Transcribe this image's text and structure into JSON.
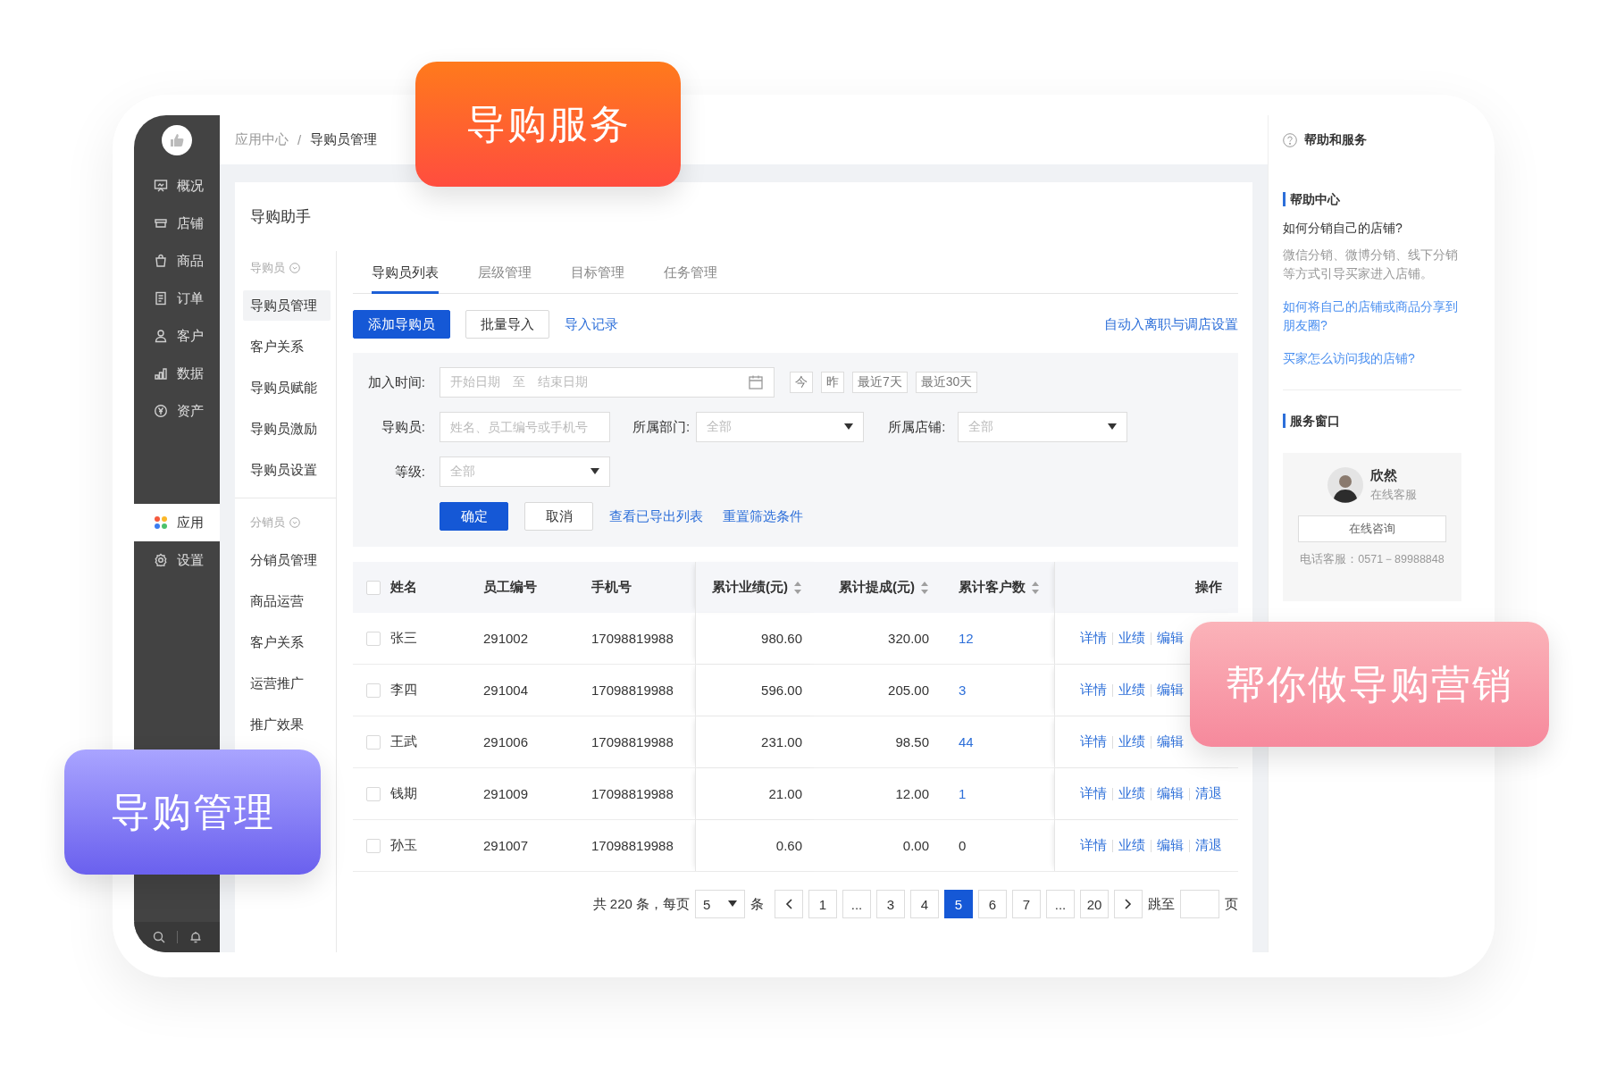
{
  "overlays": {
    "top_badge": "导购服务",
    "right_badge": "帮你做导购营销",
    "left_badge": "导购管理"
  },
  "sidebar": {
    "groups": [
      [
        {
          "label": "概况",
          "selected": false
        },
        {
          "label": "店铺",
          "selected": false
        },
        {
          "label": "商品",
          "selected": false
        },
        {
          "label": "订单",
          "selected": false
        },
        {
          "label": "客户",
          "selected": false
        },
        {
          "label": "数据",
          "selected": false
        },
        {
          "label": "资产",
          "selected": false
        }
      ],
      [
        {
          "label": "应用",
          "selected": true
        },
        {
          "label": "设置",
          "selected": false
        }
      ]
    ]
  },
  "breadcrumb": {
    "items": [
      "应用中心",
      "导购员管理"
    ],
    "separator": "/"
  },
  "app_title": "导购助手",
  "submenu": {
    "groups": [
      {
        "label": "导购员",
        "items": [
          {
            "label": "导购员管理",
            "selected": true
          },
          {
            "label": "客户关系",
            "selected": false
          },
          {
            "label": "导购员赋能",
            "selected": false
          },
          {
            "label": "导购员激励",
            "selected": false
          },
          {
            "label": "导购员设置",
            "selected": false
          }
        ]
      },
      {
        "label": "分销员",
        "items": [
          {
            "label": "分销员管理",
            "selected": false
          },
          {
            "label": "商品运营",
            "selected": false
          },
          {
            "label": "客户关系",
            "selected": false
          },
          {
            "label": "运营推广",
            "selected": false
          },
          {
            "label": "推广效果",
            "selected": false
          }
        ]
      }
    ]
  },
  "tabs": [
    {
      "label": "导购员列表",
      "selected": true
    },
    {
      "label": "层级管理",
      "selected": false
    },
    {
      "label": "目标管理",
      "selected": false
    },
    {
      "label": "任务管理",
      "selected": false
    }
  ],
  "toolbar": {
    "buttons": [
      {
        "label": "添加导购员",
        "kind": "primary"
      },
      {
        "label": "批量导入",
        "kind": "default"
      },
      {
        "label": "导入记录",
        "kind": "link"
      }
    ],
    "right_link": "自动入离职与调店设置"
  },
  "filters": {
    "date": {
      "label": "加入时间:",
      "start_placeholder": "开始日期",
      "separator": "至",
      "end_placeholder": "结束日期",
      "quick": [
        "今",
        "昨",
        "最近7天",
        "最近30天"
      ]
    },
    "guide": {
      "label": "导购员:",
      "placeholder": "姓名、员工编号或手机号"
    },
    "department": {
      "label": "所属部门:",
      "placeholder": "全部"
    },
    "store": {
      "label": "所属店铺:",
      "placeholder": "全部"
    },
    "level": {
      "label": "等级:",
      "placeholder": "全部"
    },
    "actions": [
      {
        "label": "确定",
        "kind": "primary"
      },
      {
        "label": "取消",
        "kind": "default"
      },
      {
        "label": "查看已导出列表",
        "kind": "link"
      },
      {
        "label": "重置筛选条件",
        "kind": "link"
      }
    ]
  },
  "table": {
    "select_all_checked": false,
    "columns": [
      {
        "label": "姓名",
        "sortable": false
      },
      {
        "label": "员工编号",
        "sortable": false
      },
      {
        "label": "手机号",
        "sortable": false
      },
      {
        "label": "累计业绩(元)",
        "sortable": true
      },
      {
        "label": "累计提成(元)",
        "sortable": true
      },
      {
        "label": "累计客户数",
        "sortable": true
      },
      {
        "label": "操作",
        "sortable": false
      }
    ],
    "rows": [
      {
        "checked": false,
        "name": "张三",
        "id": "291002",
        "phone": "17098819988",
        "sales": "980.60",
        "commission": "320.00",
        "customers": "12",
        "customers_link": true,
        "actions": [
          "详情",
          "业绩",
          "编辑"
        ]
      },
      {
        "checked": false,
        "name": "李四",
        "id": "291004",
        "phone": "17098819988",
        "sales": "596.00",
        "commission": "205.00",
        "customers": "3",
        "customers_link": true,
        "actions": [
          "详情",
          "业绩",
          "编辑"
        ]
      },
      {
        "checked": false,
        "name": "王武",
        "id": "291006",
        "phone": "17098819988",
        "sales": "231.00",
        "commission": "98.50",
        "customers": "44",
        "customers_link": true,
        "actions": [
          "详情",
          "业绩",
          "编辑"
        ]
      },
      {
        "checked": false,
        "name": "钱期",
        "id": "291009",
        "phone": "17098819988",
        "sales": "21.00",
        "commission": "12.00",
        "customers": "1",
        "customers_link": true,
        "actions": [
          "详情",
          "业绩",
          "编辑",
          "清退"
        ]
      },
      {
        "checked": false,
        "name": "孙玉",
        "id": "291007",
        "phone": "17098819988",
        "sales": "0.60",
        "commission": "0.00",
        "customers": "0",
        "customers_link": false,
        "actions": [
          "详情",
          "业绩",
          "编辑",
          "清退"
        ]
      }
    ]
  },
  "pagination": {
    "total_text": "共 220 条，每页",
    "page_size": "5",
    "unit": "条",
    "pages": [
      {
        "label": "1",
        "selected": false
      },
      {
        "label": "...",
        "selected": false
      },
      {
        "label": "3",
        "selected": false
      },
      {
        "label": "4",
        "selected": false
      },
      {
        "label": "5",
        "selected": true
      },
      {
        "label": "6",
        "selected": false
      },
      {
        "label": "7",
        "selected": false
      },
      {
        "label": "...",
        "selected": false
      },
      {
        "label": "20",
        "selected": false
      }
    ],
    "jump_label": "跳至",
    "page_unit": "页"
  },
  "help_panel": {
    "title": "帮助和服务",
    "help_center": {
      "heading": "帮助中心",
      "question": "如何分销自己的店铺?",
      "answer": "微信分销、微博分销、线下分销等方式引导买家进入店铺。",
      "links": [
        "如何将自己的店铺或商品分享到朋友圈?",
        "买家怎么访问我的店铺?"
      ]
    },
    "service": {
      "heading": "服务窗口",
      "agent_name": "欣然",
      "agent_role": "在线客服",
      "button": "在线咨询",
      "phone": "电话客服：0571－89988848"
    }
  }
}
